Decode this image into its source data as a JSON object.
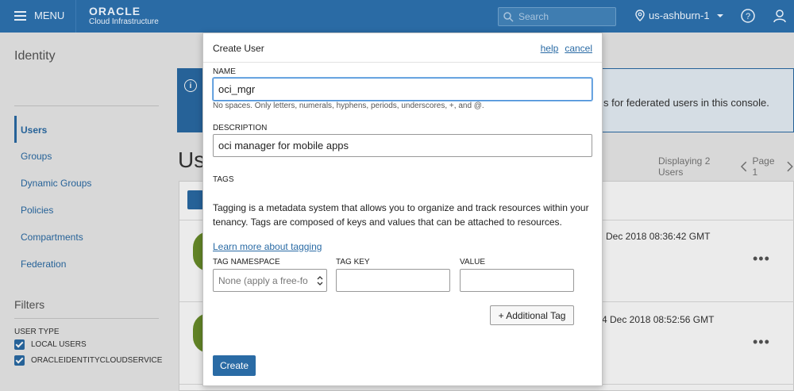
{
  "topbar": {
    "menu_label": "MENU",
    "brand": "ORACLE",
    "brand_sub": "Cloud Infrastructure",
    "search_placeholder": "Search",
    "region": "us-ashburn-1",
    "accent_color": "#2a6ba5"
  },
  "sidebar": {
    "title": "Identity",
    "items": [
      {
        "label": "Users",
        "active": true
      },
      {
        "label": "Groups"
      },
      {
        "label": "Dynamic Groups"
      },
      {
        "label": "Policies"
      },
      {
        "label": "Compartments"
      },
      {
        "label": "Federation"
      }
    ],
    "filters_title": "Filters",
    "user_type_label": "USER TYPE",
    "filters": [
      {
        "label": "LOCAL USERS",
        "checked": true
      },
      {
        "label": "ORACLEIDENTITYCLOUDSERVICE",
        "checked": true
      }
    ]
  },
  "main": {
    "banner_text": "s for federated users in this console.",
    "heading": "Us",
    "displaying": "Displaying 2 Users",
    "page": "Page 1",
    "rows": [
      {
        "date": "Dec 2018 08:36:42 GMT"
      },
      {
        "date": "4 Dec 2018 08:52:56 GMT"
      }
    ],
    "row_menu": "•••"
  },
  "modal": {
    "title": "Create User",
    "help_link": "help",
    "cancel_link": "cancel",
    "name_label": "NAME",
    "name_value": "oci_mgr",
    "name_hint": "No spaces. Only letters, numerals, hyphens, periods, underscores, +, and @.",
    "description_label": "DESCRIPTION",
    "description_value": "oci manager for mobile apps",
    "tags_label": "TAGS",
    "tags_description": "Tagging is a metadata system that allows you to organize and track resources within your tenancy. Tags are composed of keys and values that can be attached to resources.",
    "learn_more": "Learn more about tagging",
    "tag_namespace_label": "TAG NAMESPACE",
    "tag_namespace_placeholder": "None (apply a free-fo",
    "tag_key_label": "TAG KEY",
    "value_label": "VALUE",
    "additional_tag_button": "+ Additional Tag",
    "create_button": "Create"
  }
}
